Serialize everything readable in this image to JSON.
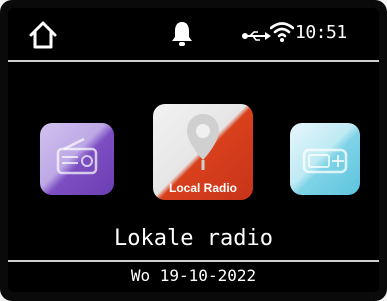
{
  "status_bar": {
    "time": "10:51",
    "icons": [
      "home-icon",
      "bell-icon",
      "usb-icon",
      "wifi-icon"
    ]
  },
  "carousel": {
    "tiles": [
      {
        "id": "previous",
        "icon": "radio-icon",
        "label": ""
      },
      {
        "id": "current",
        "icon": "location-pin-icon",
        "label": "Local Radio"
      },
      {
        "id": "next",
        "icon": "dab-radio-icon",
        "label": ""
      }
    ],
    "selected_label": "Lokale radio"
  },
  "footer": {
    "date": "Wo 19-10-2022"
  },
  "colors": {
    "screen_bg": "#000000",
    "text": "#ffffff",
    "divider": "#cfcfcf",
    "tile_prev": "#7c4ec2",
    "tile_current": "#d9401c",
    "tile_next": "#7fd3e7"
  }
}
